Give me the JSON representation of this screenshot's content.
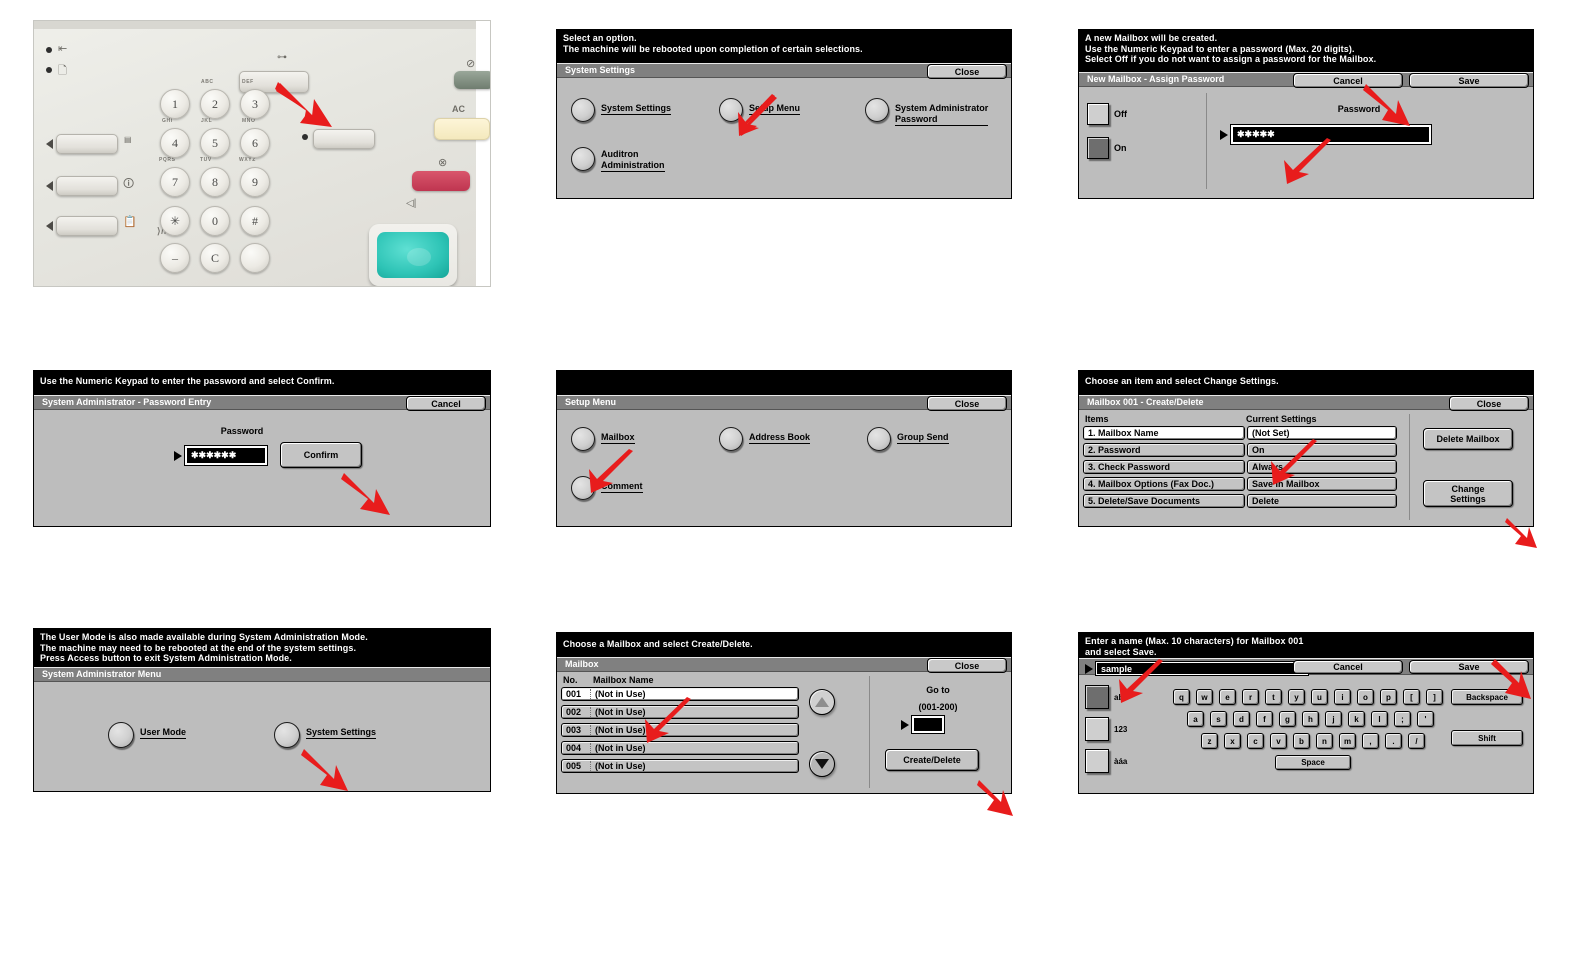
{
  "document": {
    "kind": "printer-control-panel-instruction-sheet",
    "panel_count": 9
  },
  "photo": {
    "name": "copier-control-panel-photo",
    "ac_label": "AC",
    "keypad": [
      {
        "digit": "1",
        "letters": ""
      },
      {
        "digit": "2",
        "letters": "ABC"
      },
      {
        "digit": "3",
        "letters": "DEF"
      },
      {
        "digit": "4",
        "letters": "GHI"
      },
      {
        "digit": "5",
        "letters": "JKL"
      },
      {
        "digit": "6",
        "letters": "MNO"
      },
      {
        "digit": "7",
        "letters": "PQRS"
      },
      {
        "digit": "8",
        "letters": "TUV"
      },
      {
        "digit": "9",
        "letters": "WXYZ"
      },
      {
        "digit": "✳",
        "letters": ""
      },
      {
        "digit": "0",
        "letters": "C"
      },
      {
        "digit": "#",
        "letters": ""
      },
      {
        "digit": "–",
        "letters": "ʕ//"
      },
      {
        "digit": "C",
        "letters": "C"
      },
      {
        "digit": "",
        "letters": "□"
      }
    ]
  },
  "p_system_settings": {
    "name": "system-settings-panel",
    "message": [
      "Select an option.",
      "The machine will be rebooted upon completion of certain selections."
    ],
    "title": "System Settings",
    "close_label": "Close",
    "options": [
      {
        "label": "System Settings"
      },
      {
        "label": "Setup Menu"
      },
      {
        "label": "System Administrator\nPassword"
      },
      {
        "label": "Auditron\nAdministration"
      }
    ]
  },
  "p_assign_password": {
    "name": "new-mailbox-assign-password-panel",
    "message": [
      "A new Mailbox will be created.",
      "Use the Numeric Keypad to enter a password (Max. 20 digits).",
      "Select Off if you do not want to assign a password for the Mailbox."
    ],
    "title": "New Mailbox - Assign Password",
    "cancel_label": "Cancel",
    "save_label": "Save",
    "off_label": "Off",
    "on_label": "On",
    "selected": "On",
    "password_heading": "Password",
    "password_value": "✱✱✱✱✱"
  },
  "p_password_entry": {
    "name": "system-administrator-password-entry-panel",
    "message": [
      "Use the Numeric Keypad to enter the password and select Confirm."
    ],
    "title": "System Administrator - Password Entry",
    "cancel_label": "Cancel",
    "password_heading": "Password",
    "password_value": "✱✱✱✱✱✱",
    "confirm_label": "Confirm"
  },
  "p_setup_menu": {
    "name": "setup-menu-panel",
    "message": [
      ""
    ],
    "title": "Setup Menu",
    "close_label": "Close",
    "options": [
      {
        "label": "Mailbox"
      },
      {
        "label": "Address Book"
      },
      {
        "label": "Group Send"
      },
      {
        "label": "Comment"
      }
    ]
  },
  "p_mailbox_create": {
    "name": "mailbox-001-create-delete-panel",
    "message": [
      "Choose an item and select Change Settings."
    ],
    "title": "Mailbox 001 - Create/Delete",
    "close_label": "Close",
    "columns": [
      "Items",
      "Current Settings"
    ],
    "rows": [
      {
        "item": "1. Mailbox Name",
        "setting": "(Not Set)",
        "selected": true
      },
      {
        "item": "2. Password",
        "setting": "On",
        "selected": false
      },
      {
        "item": "3. Check Password",
        "setting": "Always",
        "selected": false
      },
      {
        "item": "4. Mailbox Options (Fax Doc.)",
        "setting": "Save in Mailbox",
        "selected": false
      },
      {
        "item": "5. Delete/Save Documents",
        "setting": "Delete",
        "selected": false
      }
    ],
    "delete_label": "Delete Mailbox",
    "change_label": "Change\nSettings"
  },
  "p_admin_menu": {
    "name": "system-administrator-menu-panel",
    "message": [
      "The User Mode is also made available during System Administration Mode.",
      "The machine may need to be rebooted at the end of the system settings.",
      "Press Access button to exit System Administration Mode."
    ],
    "title": "System Administrator Menu",
    "options": [
      {
        "label": "User Mode"
      },
      {
        "label": "System Settings"
      }
    ]
  },
  "p_mailbox_list": {
    "name": "mailbox-list-panel",
    "message": [
      "Choose a Mailbox and select Create/Delete."
    ],
    "title": "Mailbox",
    "close_label": "Close",
    "columns": [
      "No.",
      "Mailbox Name"
    ],
    "rows": [
      {
        "no": "001",
        "name": "(Not in Use)",
        "selected": true
      },
      {
        "no": "002",
        "name": "(Not in Use)",
        "selected": false
      },
      {
        "no": "003",
        "name": "(Not in Use)",
        "selected": false
      },
      {
        "no": "004",
        "name": "(Not in Use)",
        "selected": false
      },
      {
        "no": "005",
        "name": "(Not in Use)",
        "selected": false
      }
    ],
    "goto_label": "Go to",
    "goto_range": "(001-200)",
    "goto_value": "",
    "create_label": "Create/Delete"
  },
  "p_keyboard": {
    "name": "mailbox-name-entry-panel",
    "message": [
      "Enter a name (Max. 10 characters) for Mailbox 001",
      "and select Save."
    ],
    "name_value": "sample",
    "cancel_label": "Cancel",
    "save_label": "Save",
    "modes": [
      {
        "label": "abc",
        "selected": true
      },
      {
        "label": "123",
        "selected": false
      },
      {
        "label": "àáa",
        "selected": false
      }
    ],
    "rows": [
      [
        "q",
        "w",
        "e",
        "r",
        "t",
        "y",
        "u",
        "i",
        "o",
        "p",
        "[",
        "]"
      ],
      [
        "a",
        "s",
        "d",
        "f",
        "g",
        "h",
        "j",
        "k",
        "l",
        ";",
        "'"
      ],
      [
        "z",
        "x",
        "c",
        "v",
        "b",
        "n",
        "m",
        ",",
        ".",
        "/"
      ]
    ],
    "space_label": "Space",
    "backspace_label": "Backspace",
    "shift_label": "Shift"
  },
  "colors": {
    "panel_body": "#bdbdbd",
    "title_bar": "#808080",
    "message_bar": "#000000",
    "arrow_red": "#e81c1c",
    "start_button_teal": "#2ec4b6",
    "stop_button_red": "#bf3550",
    "ac_button_cream": "#f4e9bd"
  }
}
